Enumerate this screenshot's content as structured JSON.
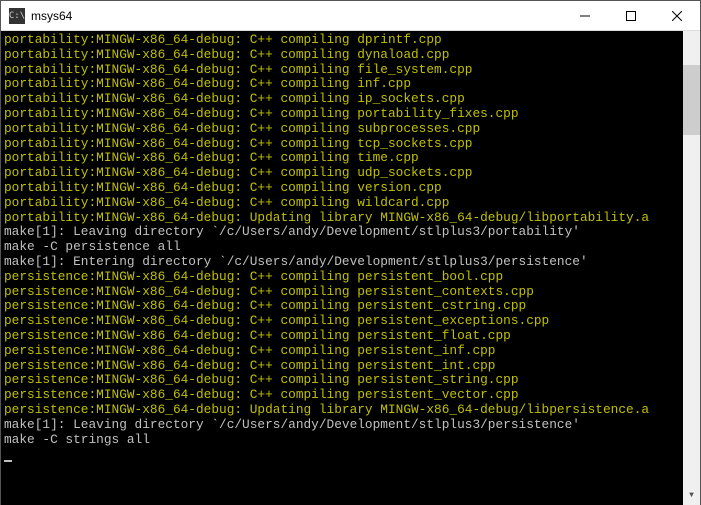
{
  "window": {
    "title": "msys64",
    "icon_label": "C:\\"
  },
  "terminal": {
    "lines": [
      {
        "cls": "yellow",
        "text": "portability:MINGW-x86_64-debug: C++ compiling dprintf.cpp"
      },
      {
        "cls": "yellow",
        "text": "portability:MINGW-x86_64-debug: C++ compiling dynaload.cpp"
      },
      {
        "cls": "yellow",
        "text": "portability:MINGW-x86_64-debug: C++ compiling file_system.cpp"
      },
      {
        "cls": "yellow",
        "text": "portability:MINGW-x86_64-debug: C++ compiling inf.cpp"
      },
      {
        "cls": "yellow",
        "text": "portability:MINGW-x86_64-debug: C++ compiling ip_sockets.cpp"
      },
      {
        "cls": "yellow",
        "text": "portability:MINGW-x86_64-debug: C++ compiling portability_fixes.cpp"
      },
      {
        "cls": "yellow",
        "text": "portability:MINGW-x86_64-debug: C++ compiling subprocesses.cpp"
      },
      {
        "cls": "yellow",
        "text": "portability:MINGW-x86_64-debug: C++ compiling tcp_sockets.cpp"
      },
      {
        "cls": "yellow",
        "text": "portability:MINGW-x86_64-debug: C++ compiling time.cpp"
      },
      {
        "cls": "yellow",
        "text": "portability:MINGW-x86_64-debug: C++ compiling udp_sockets.cpp"
      },
      {
        "cls": "yellow",
        "text": "portability:MINGW-x86_64-debug: C++ compiling version.cpp"
      },
      {
        "cls": "yellow",
        "text": "portability:MINGW-x86_64-debug: C++ compiling wildcard.cpp"
      },
      {
        "cls": "yellow",
        "text": "portability:MINGW-x86_64-debug: Updating library MINGW-x86_64-debug/libportability.a"
      },
      {
        "cls": "",
        "text": "make[1]: Leaving directory `/c/Users/andy/Development/stlplus3/portability'"
      },
      {
        "cls": "",
        "text": "make -C persistence all"
      },
      {
        "cls": "",
        "text": "make[1]: Entering directory `/c/Users/andy/Development/stlplus3/persistence'"
      },
      {
        "cls": "yellow",
        "text": "persistence:MINGW-x86_64-debug: C++ compiling persistent_bool.cpp"
      },
      {
        "cls": "yellow",
        "text": "persistence:MINGW-x86_64-debug: C++ compiling persistent_contexts.cpp"
      },
      {
        "cls": "yellow",
        "text": "persistence:MINGW-x86_64-debug: C++ compiling persistent_cstring.cpp"
      },
      {
        "cls": "yellow",
        "text": "persistence:MINGW-x86_64-debug: C++ compiling persistent_exceptions.cpp"
      },
      {
        "cls": "yellow",
        "text": "persistence:MINGW-x86_64-debug: C++ compiling persistent_float.cpp"
      },
      {
        "cls": "yellow",
        "text": "persistence:MINGW-x86_64-debug: C++ compiling persistent_inf.cpp"
      },
      {
        "cls": "yellow",
        "text": "persistence:MINGW-x86_64-debug: C++ compiling persistent_int.cpp"
      },
      {
        "cls": "yellow",
        "text": "persistence:MINGW-x86_64-debug: C++ compiling persistent_string.cpp"
      },
      {
        "cls": "yellow",
        "text": "persistence:MINGW-x86_64-debug: C++ compiling persistent_vector.cpp"
      },
      {
        "cls": "yellow",
        "text": "persistence:MINGW-x86_64-debug: Updating library MINGW-x86_64-debug/libpersistence.a"
      },
      {
        "cls": "",
        "text": "make[1]: Leaving directory `/c/Users/andy/Development/stlplus3/persistence'"
      },
      {
        "cls": "",
        "text": "make -C strings all"
      }
    ]
  }
}
